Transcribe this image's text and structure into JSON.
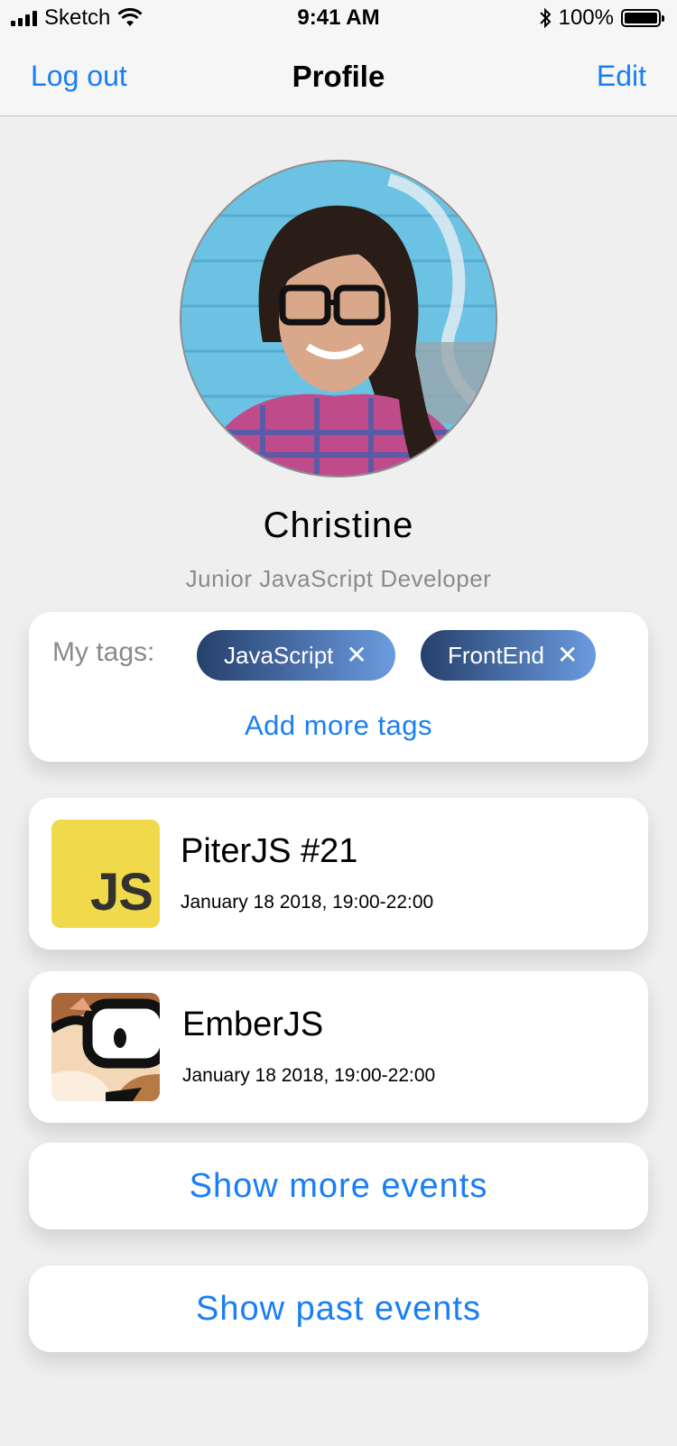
{
  "status": {
    "carrier": "Sketch",
    "time": "9:41 AM",
    "battery": "100%",
    "icons": [
      "signal-icon",
      "wifi-icon",
      "bluetooth-icon",
      "battery-icon"
    ]
  },
  "nav": {
    "left": "Log out",
    "title": "Profile",
    "right": "Edit"
  },
  "profile": {
    "name": "Christine",
    "role": "Junior JavaScript Developer"
  },
  "tags": {
    "label": "My tags:",
    "items": [
      {
        "label": "JavaScript"
      },
      {
        "label": "FrontEnd"
      }
    ],
    "add": "Add more tags"
  },
  "events": [
    {
      "title": "PiterJS #21",
      "date": "January 18 2018, 19:00-22:00",
      "thumb_text": "JS"
    },
    {
      "title": "EmberJS",
      "date": "January 18 2018, 19:00-22:00"
    }
  ],
  "buttons": {
    "more": "Show more events",
    "past": "Show past events"
  },
  "colors": {
    "accent": "#1a7ef5",
    "tag_start": "#25406b",
    "tag_end": "#6b9be0",
    "js_yellow": "#f0da4b"
  }
}
